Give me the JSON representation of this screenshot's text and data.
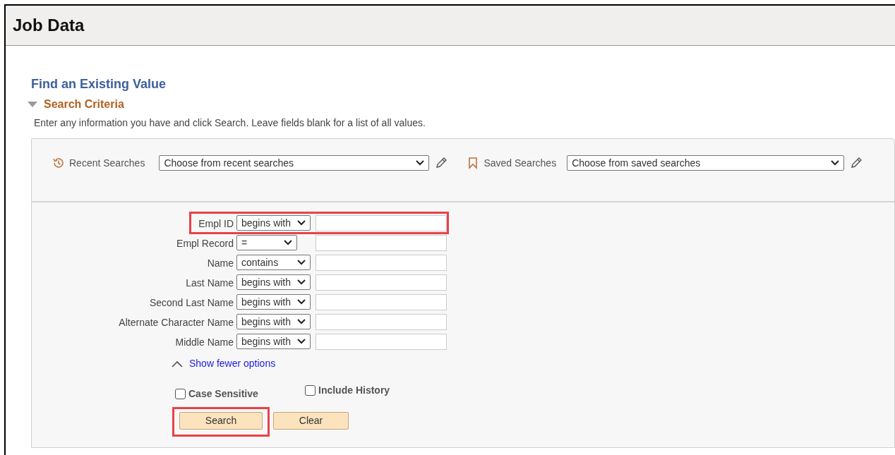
{
  "page_title": "Job Data",
  "heading": "Find an Existing Value",
  "section": {
    "title": "Search Criteria",
    "expanded": true
  },
  "instructions": "Enter any information you have and click Search. Leave fields blank for a list of all values.",
  "recent_searches": {
    "label": "Recent Searches",
    "value": "Choose from recent searches"
  },
  "saved_searches": {
    "label": "Saved Searches",
    "value": "Choose from saved searches"
  },
  "fields": [
    {
      "label": "Empl ID",
      "operator": "begins with",
      "highlighted": true
    },
    {
      "label": "Empl Record",
      "operator": "=",
      "highlighted": false
    },
    {
      "label": "Name",
      "operator": "contains",
      "highlighted": false
    },
    {
      "label": "Last Name",
      "operator": "begins with",
      "highlighted": false
    },
    {
      "label": "Second Last Name",
      "operator": "begins with",
      "highlighted": false
    },
    {
      "label": "Alternate Character Name",
      "operator": "begins with",
      "highlighted": false
    },
    {
      "label": "Middle Name",
      "operator": "begins with",
      "highlighted": false
    }
  ],
  "show_fewer_link": "Show fewer options",
  "options": [
    {
      "label": "Case Sensitive",
      "checked": false
    },
    {
      "label": "Include History",
      "checked": false
    }
  ],
  "buttons": [
    {
      "label": "Search",
      "highlighted": true
    },
    {
      "label": "Clear",
      "highlighted": false
    }
  ]
}
